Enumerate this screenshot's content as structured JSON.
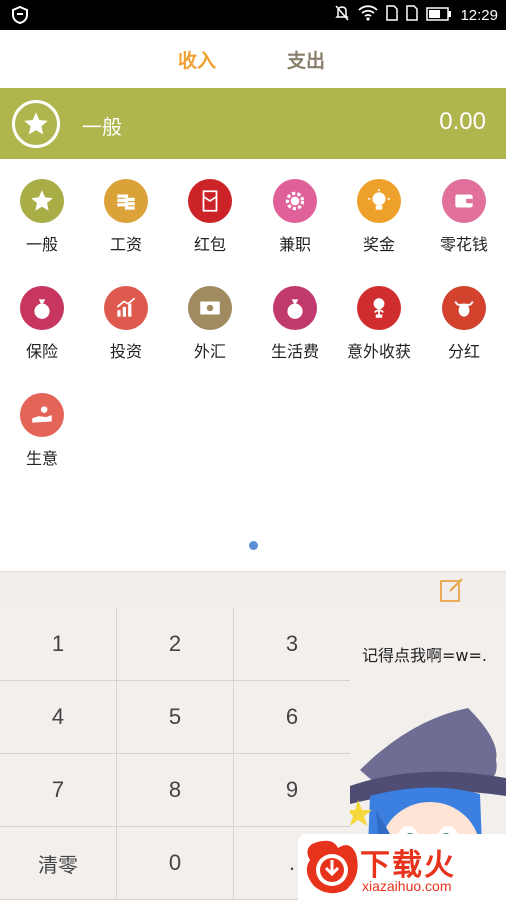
{
  "status_bar": {
    "time": "12:29",
    "icons": [
      "shield-icon",
      "mute-icon",
      "wifi-icon",
      "sim-icon",
      "sim-icon",
      "battery-icon"
    ]
  },
  "tabs": [
    {
      "label": "收入",
      "active": true
    },
    {
      "label": "支出",
      "active": false
    }
  ],
  "colors": {
    "accent": "#f0a030",
    "selected_bar": "#b0b64e",
    "tab_inactive": "#8a7e6c"
  },
  "selected": {
    "icon": "star-icon",
    "name": "一般",
    "amount": "0.00"
  },
  "categories": [
    {
      "label": "一般",
      "icon": "star-icon",
      "color": "#a8ad46"
    },
    {
      "label": "工资",
      "icon": "coins-icon",
      "color": "#dba23a"
    },
    {
      "label": "红包",
      "icon": "red-envelope-icon",
      "color": "#cc2329"
    },
    {
      "label": "兼职",
      "icon": "gear-dollar-icon",
      "color": "#e0619a"
    },
    {
      "label": "奖金",
      "icon": "lightbulb-dollar-icon",
      "color": "#eda12a"
    },
    {
      "label": "零花钱",
      "icon": "wallet-icon",
      "color": "#e2709c"
    },
    {
      "label": "保险",
      "icon": "money-bag-icon",
      "color": "#c7365f"
    },
    {
      "label": "投资",
      "icon": "bar-chart-icon",
      "color": "#df5a4e"
    },
    {
      "label": "外汇",
      "icon": "banknote-icon",
      "color": "#a08a60"
    },
    {
      "label": "生活费",
      "icon": "money-bag-icon",
      "color": "#c13a6e"
    },
    {
      "label": "意外收获",
      "icon": "money-plant-icon",
      "color": "#d02e2e"
    },
    {
      "label": "分红",
      "icon": "bull-icon",
      "color": "#d2422c"
    },
    {
      "label": "生意",
      "icon": "hand-coin-icon",
      "color": "#e46458"
    }
  ],
  "keypad": {
    "keys": [
      "1",
      "2",
      "3",
      "4",
      "5",
      "6",
      "7",
      "8",
      "9",
      "清零",
      "0",
      "."
    ],
    "hint": "记得点我啊=w=.",
    "note_icon": "edit-note-icon"
  },
  "watermark": {
    "title": "下载火",
    "subtitle": "xiazaihuo.com"
  }
}
